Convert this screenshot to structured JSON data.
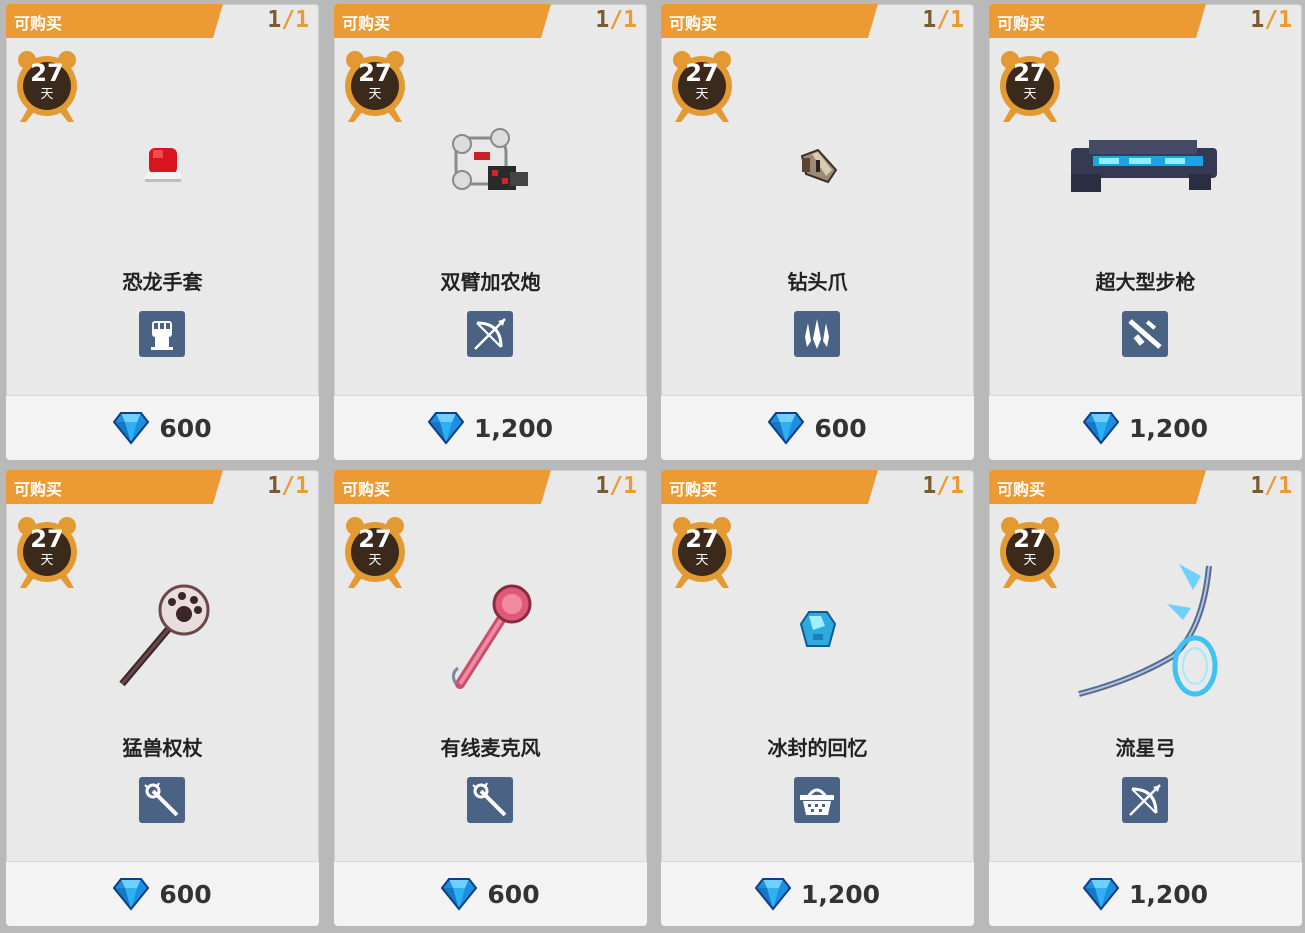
{
  "ui": {
    "available_label": "可购买",
    "count_current": "1",
    "count_sep": "/",
    "count_max": "1",
    "timer_days": "27",
    "timer_unit": "天",
    "colors": {
      "ribbon": "#eb9a34",
      "badge": "#4a6384",
      "timer_ring": "#e49a32",
      "timer_face": "#3b2a1c"
    }
  },
  "items": [
    {
      "name": "恐龙手套",
      "type_icon": "fist-icon",
      "price": "600",
      "art": "red-glove-icon"
    },
    {
      "name": "双臂加农炮",
      "type_icon": "bow-icon",
      "price": "1,200",
      "art": "cannon-icon"
    },
    {
      "name": "钻头爪",
      "type_icon": "claw-icon",
      "price": "600",
      "art": "drill-claw-icon"
    },
    {
      "name": "超大型步枪",
      "type_icon": "rifle-icon",
      "price": "1,200",
      "art": "rifle-art-icon"
    },
    {
      "name": "猛兽权杖",
      "type_icon": "staff-icon",
      "price": "600",
      "art": "paw-scepter-icon"
    },
    {
      "name": "有线麦克风",
      "type_icon": "staff-icon",
      "price": "600",
      "art": "microphone-icon"
    },
    {
      "name": "冰封的回忆",
      "type_icon": "basket-icon",
      "price": "1,200",
      "art": "ice-gem-icon"
    },
    {
      "name": "流星弓",
      "type_icon": "bow-icon",
      "price": "1,200",
      "art": "meteor-bow-icon"
    }
  ]
}
